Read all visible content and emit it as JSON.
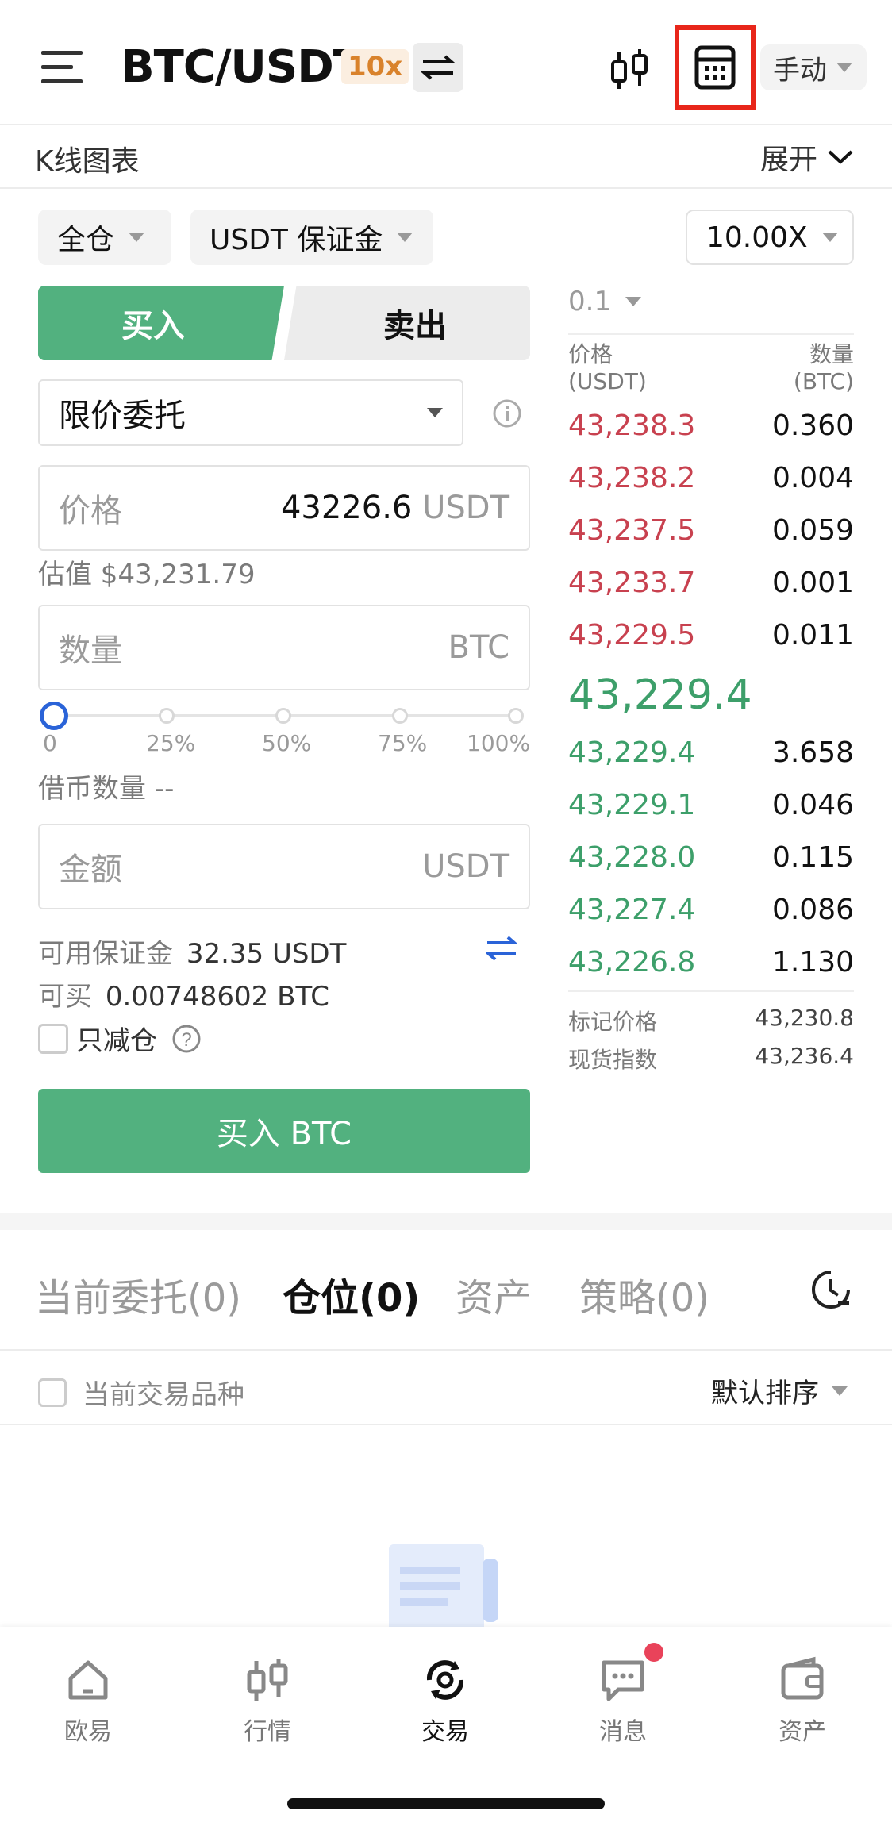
{
  "header": {
    "pair": "BTC/USDT",
    "leverage_badge": "10x",
    "mode_label": "手动"
  },
  "kline_bar": {
    "label": "K线图表",
    "expand_label": "展开"
  },
  "settings": {
    "margin_mode": "全仓",
    "margin_asset": "USDT 保证金",
    "leverage": "10.00X"
  },
  "order_form": {
    "buy_tab": "买入",
    "sell_tab": "卖出",
    "order_type": "限价委托",
    "price_label": "价格",
    "price_value": "43226.6",
    "price_unit": "USDT",
    "estimate": "估值 $43,231.79",
    "qty_label": "数量",
    "qty_unit": "BTC",
    "slider_marks": [
      "0",
      "25%",
      "50%",
      "75%",
      "100%"
    ],
    "slider_value": 0,
    "borrow_label": "借币数量 --",
    "amount_label": "金额",
    "amount_unit": "USDT",
    "available_label": "可用保证金",
    "available_value": "32.35 USDT",
    "can_buy_label": "可买",
    "can_buy_value": "0.00748602 BTC",
    "reduce_only": "只减仓",
    "submit": "买入 BTC"
  },
  "orderbook": {
    "precision": "0.1",
    "price_header": "价格",
    "price_unit": "(USDT)",
    "qty_header": "数量",
    "qty_unit": "(BTC)",
    "asks": [
      {
        "price": "43,238.3",
        "qty": "0.360"
      },
      {
        "price": "43,238.2",
        "qty": "0.004"
      },
      {
        "price": "43,237.5",
        "qty": "0.059"
      },
      {
        "price": "43,233.7",
        "qty": "0.001"
      },
      {
        "price": "43,229.5",
        "qty": "0.011"
      }
    ],
    "last_price": "43,229.4",
    "bids": [
      {
        "price": "43,229.4",
        "qty": "3.658"
      },
      {
        "price": "43,229.1",
        "qty": "0.046"
      },
      {
        "price": "43,228.0",
        "qty": "0.115"
      },
      {
        "price": "43,227.4",
        "qty": "0.086"
      },
      {
        "price": "43,226.8",
        "qty": "1.130"
      }
    ],
    "mark_price_label": "标记价格",
    "mark_price": "43,230.8",
    "spot_index_label": "现货指数",
    "spot_index": "43,236.4"
  },
  "positions": {
    "tabs": [
      "当前委托(0)",
      "仓位(0)",
      "资产",
      "策略(0)"
    ],
    "active_tab": 1,
    "filter_label": "当前交易品种",
    "sort_label": "默认排序"
  },
  "bottom_nav": {
    "items": [
      "欧易",
      "行情",
      "交易",
      "消息",
      "资产"
    ],
    "active": 2
  },
  "colors": {
    "buy_green": "#52b17f",
    "ask_red": "#c8414f",
    "bid_green": "#3d9f6a",
    "highlight_red": "#e8261a",
    "badge_orange": "#d9822b"
  }
}
